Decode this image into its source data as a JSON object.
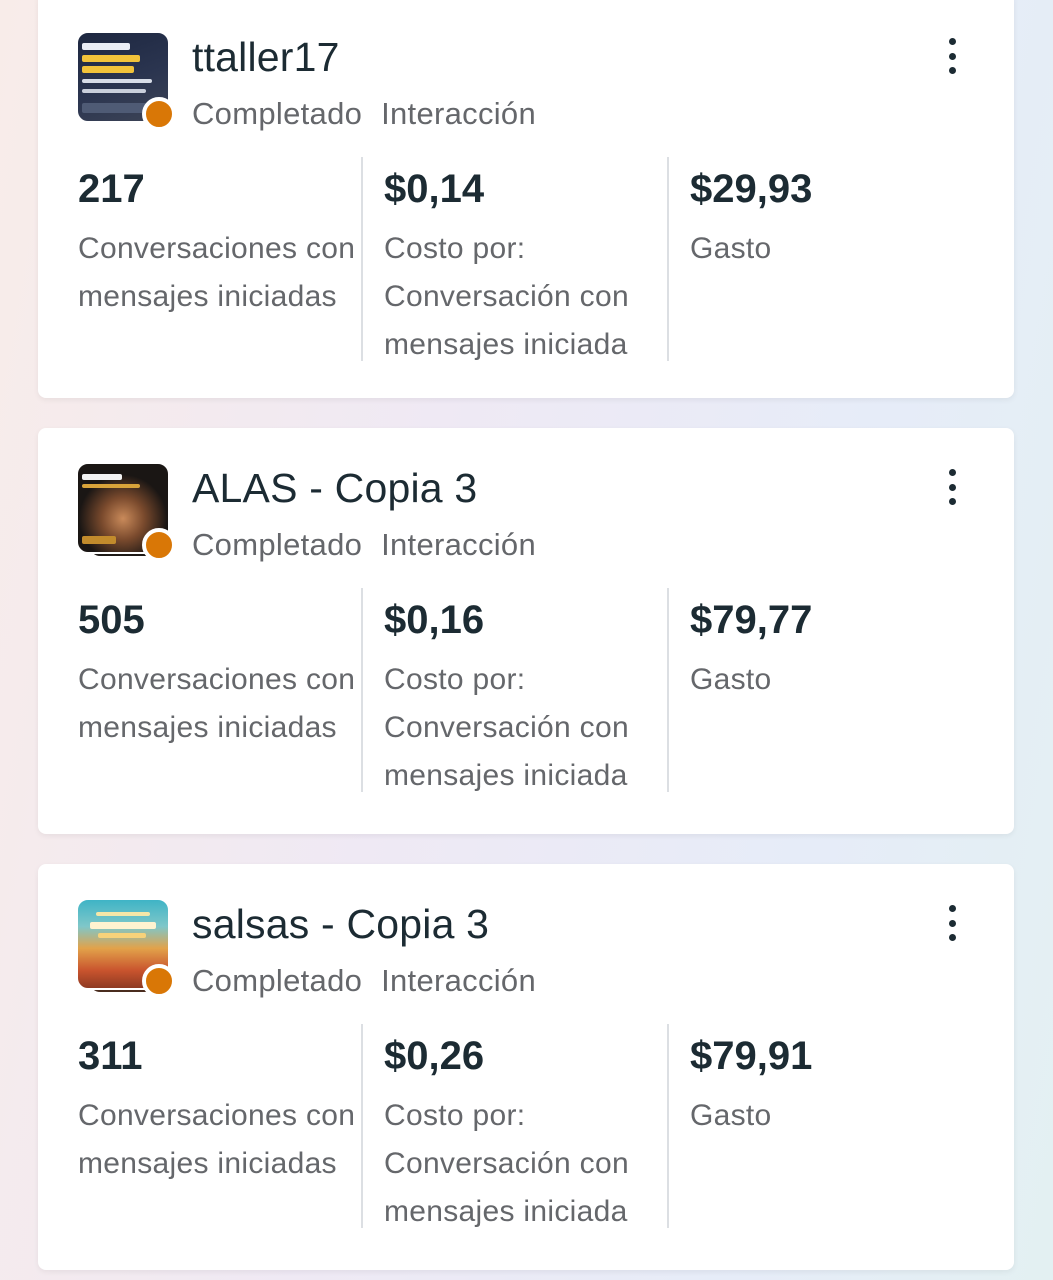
{
  "colors": {
    "status_dot": "#d97706",
    "text_primary": "#1c2b33",
    "text_secondary": "#65676b"
  },
  "ads": [
    {
      "name": "ttaller17",
      "status": "Completado",
      "objective": "Interacción",
      "thumbnail_icon": "ad-creative-thumbnail",
      "metrics": [
        {
          "value": "217",
          "label": "Conversaciones con mensajes iniciadas"
        },
        {
          "value": "$0,14",
          "label": "Costo por: Conversación con mensajes iniciada"
        },
        {
          "value": "$29,93",
          "label": "Gasto"
        }
      ]
    },
    {
      "name": "ALAS - Copia 3",
      "status": "Completado",
      "objective": "Interacción",
      "thumbnail_icon": "ad-creative-thumbnail",
      "metrics": [
        {
          "value": "505",
          "label": "Conversaciones con mensajes iniciadas"
        },
        {
          "value": "$0,16",
          "label": "Costo por: Conversación con mensajes iniciada"
        },
        {
          "value": "$79,77",
          "label": "Gasto"
        }
      ]
    },
    {
      "name": "salsas - Copia 3",
      "status": "Completado",
      "objective": "Interacción",
      "thumbnail_icon": "ad-creative-thumbnail",
      "metrics": [
        {
          "value": "311",
          "label": "Conversaciones con mensajes iniciadas"
        },
        {
          "value": "$0,26",
          "label": "Costo por: Conversación con mensajes iniciada"
        },
        {
          "value": "$79,91",
          "label": "Gasto"
        }
      ]
    }
  ]
}
